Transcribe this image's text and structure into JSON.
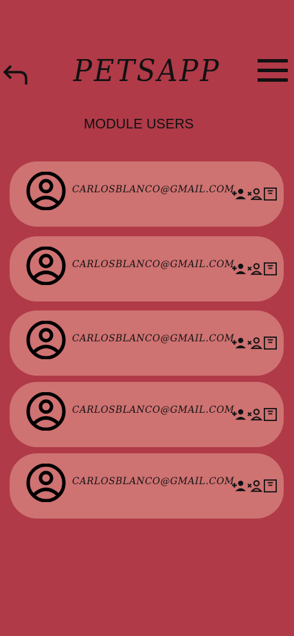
{
  "app": {
    "title": "PETSAPP"
  },
  "page": {
    "title": "MODULE USERS"
  },
  "users": [
    {
      "email": "CARLOSBLANCO@GMAIL.COM"
    },
    {
      "email": "CARLOSBLANCO@GMAIL.COM"
    },
    {
      "email": "CARLOSBLANCO@GMAIL.COM"
    },
    {
      "email": "CARLOSBLANCO@GMAIL.COM"
    },
    {
      "email": "CARLOSBLANCO@GMAIL.COM"
    }
  ],
  "icons": {
    "back": "undo-arrow-icon",
    "menu": "hamburger-menu-icon",
    "avatar": "account-circle-icon",
    "add": "person-add-icon",
    "remove": "person-remove-icon",
    "details": "document-box-icon"
  },
  "colors": {
    "background": "#b03a48",
    "card": "#cf7272",
    "ink": "#111111"
  }
}
